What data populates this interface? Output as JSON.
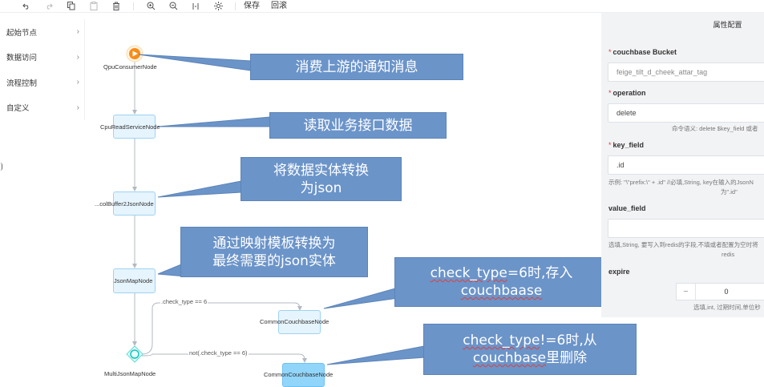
{
  "toolbar": {
    "icons": [
      "undo-icon",
      "redo-icon",
      "copy-icon",
      "paste-icon",
      "delete-icon",
      "zoom-in-icon",
      "zoom-out-icon",
      "fit-icon",
      "auto-layout-icon"
    ],
    "save_label": "保存",
    "rollback_label": "回滚"
  },
  "sidebar": {
    "items": [
      {
        "label": "起始节点"
      },
      {
        "label": "数据访问"
      },
      {
        "label": "流程控制"
      },
      {
        "label": "自定义"
      }
    ]
  },
  "canvas": {
    "nodes": [
      {
        "label": "QpuConsumerNode"
      },
      {
        "label": "CpuReadServiceNode"
      },
      {
        "label": "...colBuffer2JsonNode"
      },
      {
        "label": "JsonMapNode"
      },
      {
        "label": "CommonCouchbaseNode"
      },
      {
        "label": "MultiJsonMapNode"
      },
      {
        "label": "CommonCouchbaseNode"
      }
    ],
    "edges": [
      {
        "label": ".check_type == 6"
      },
      {
        "label": "not(.check_type == 6)"
      }
    ]
  },
  "callouts": [
    {
      "text": "消费上游的通知消息"
    },
    {
      "text": "读取业务接口数据"
    },
    {
      "line1": "将数据实体转换",
      "line2": "为json"
    },
    {
      "line1": "通过映射模板转换为",
      "line2": "最终需要的json实体"
    },
    {
      "line1_a": "check_type",
      "line1_b": "=6时,存入",
      "line2": "couchbaase"
    },
    {
      "line1_a": "check_type",
      "line1_b": "!=6时,从",
      "line2_a": "couchbase",
      "line2_b": "里删除"
    }
  ],
  "panel": {
    "title": "属性配置",
    "bucket": {
      "label": "couchbase Bucket",
      "value": "feige_tilt_d_cheek_attar_tag"
    },
    "operation": {
      "label": "operation",
      "value": "delete",
      "hint": "命令语义: delete $key_field 或者"
    },
    "key_field": {
      "label": "key_field",
      "value": ".id",
      "hint1": "示例: \"\\\"prefix:\\\" + .id\" //必填,String, key在输入的JsonN",
      "hint2": "为\".id\""
    },
    "value_field": {
      "label": "value_field",
      "value": "",
      "hint1": "选填,String, 要写入到redis的字段,不填或者配置为空时将",
      "hint2": "redis"
    },
    "expire": {
      "label": "expire",
      "minus": "−",
      "value": "0",
      "hint": "选填,int, 过期时间,单位秒"
    }
  },
  "colors": {
    "callout": "#6b94c9",
    "node": "#e6f4fd",
    "node_border": "#9fd3f1",
    "node_selected": "#91d5fb",
    "start": "#fa8c16",
    "edge": "#b3b9c2"
  }
}
